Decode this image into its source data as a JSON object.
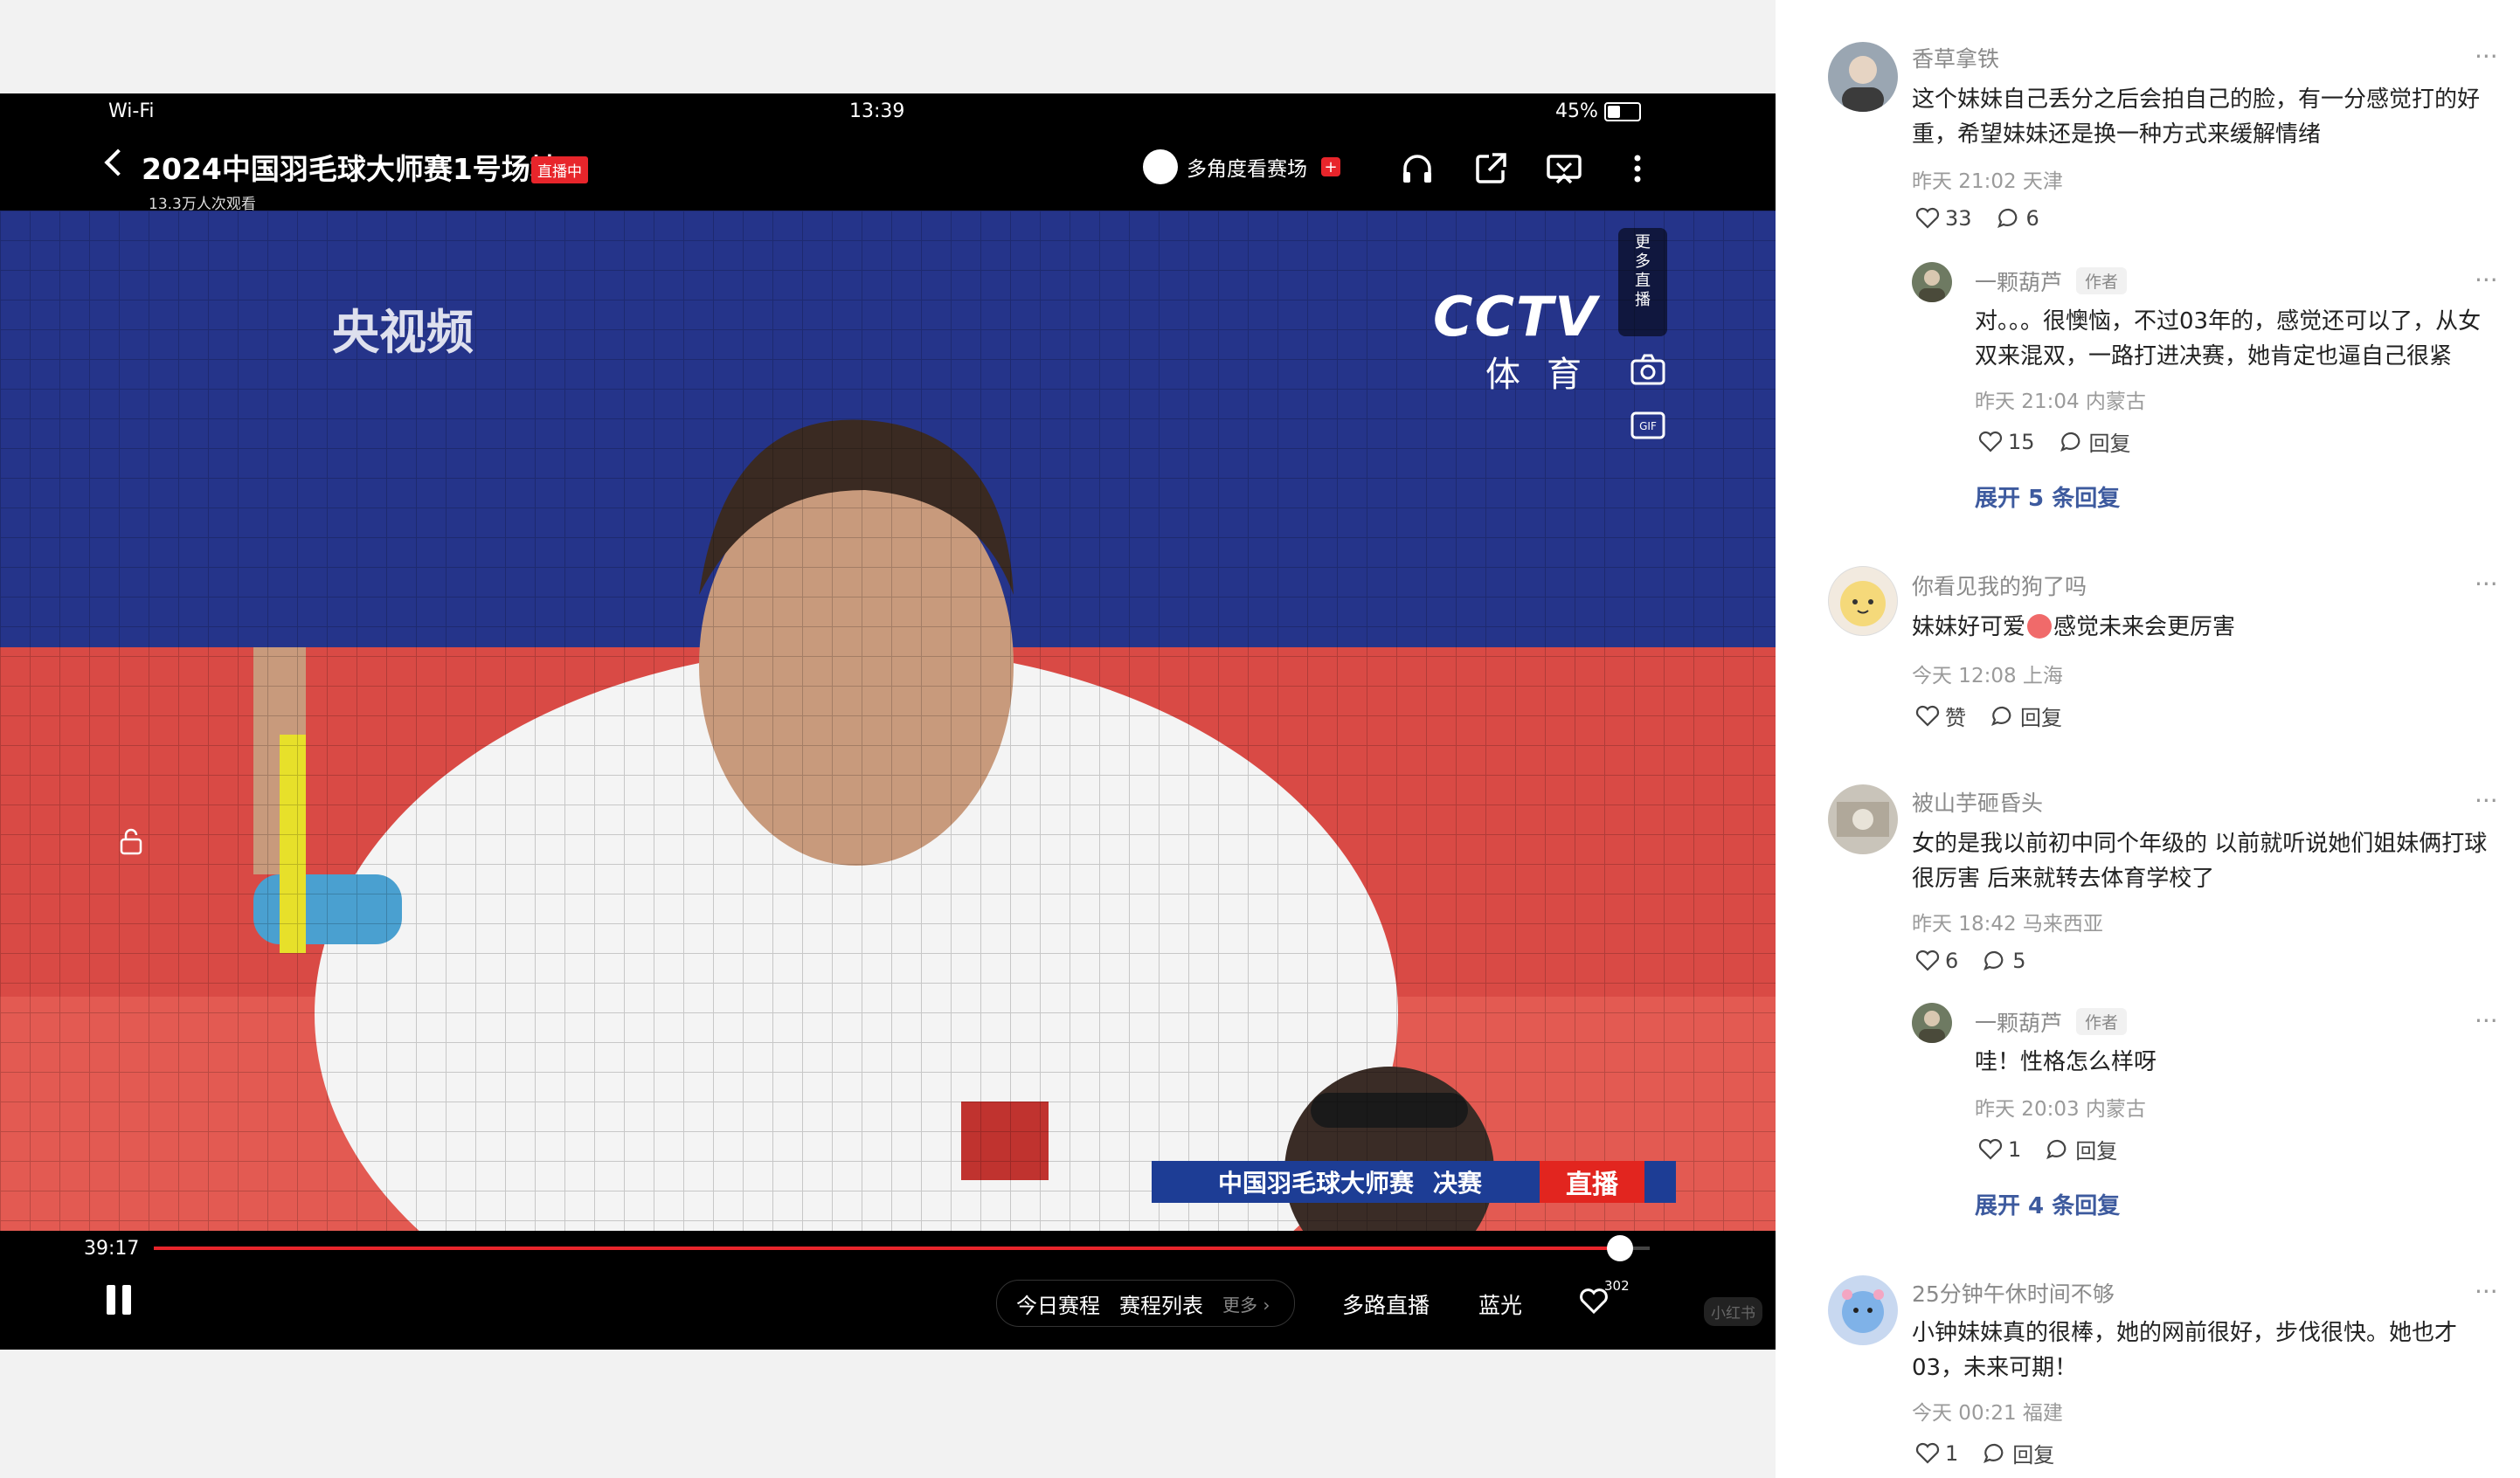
{
  "status_bar": {
    "wifi": "Wi-Fi",
    "time": "13:39",
    "battery": "45%"
  },
  "player": {
    "title": "2024中国羽毛球大师赛1号场地",
    "live_badge": "直播中",
    "viewers": "13.3万人次观看",
    "multi_angle_label": "多角度看赛场",
    "more_live": [
      "更",
      "多",
      "直",
      "播"
    ],
    "watermark_left": "央视频",
    "watermark_cctv": "CCTV",
    "watermark_sport": "体育",
    "ticker_event": "中国羽毛球大师赛",
    "ticker_round": "决赛",
    "ticker_live": "直播",
    "time_elapsed": "39:17",
    "progress_fraction": 0.98,
    "today_schedule": "今日赛程",
    "schedule_list": "赛程列表",
    "more": "更多",
    "multi_live": "多路直播",
    "quality": "蓝光",
    "like_count": "302",
    "corner_mark": "小红书"
  },
  "comments": [
    {
      "name": "香草拿铁",
      "text": "这个妹妹自己丢分之后会拍自己的脸，有一分感觉打的好重，希望妹妹还是换一种方式来缓解情绪",
      "meta": "昨天 21:02 天津",
      "likes": "33",
      "replies": "6",
      "more": "···"
    },
    {
      "name": "一颗葫芦",
      "author": "作者",
      "text": "对。。。很懊恼，不过03年的，感觉还可以了，从女双来混双，一路打进决赛，她肯定也逼自己很紧",
      "meta": "昨天 21:04 内蒙古",
      "likes": "15",
      "replies": "回复",
      "more": "···",
      "expand": "展开 5 条回复"
    },
    {
      "name": "你看见我的狗了吗",
      "text_before": "妹妹好可爱",
      "text_after": "感觉未来会更厉害",
      "meta": "今天 12:08 上海",
      "likes": "赞",
      "replies": "回复",
      "more": "···"
    },
    {
      "name": "被山芋砸昏头",
      "text": "女的是我以前初中同个年级的 以前就听说她们姐妹俩打球很厉害 后来就转去体育学校了",
      "meta": "昨天 18:42 马来西亚",
      "likes": "6",
      "replies": "5",
      "more": "···"
    },
    {
      "name": "一颗葫芦",
      "author": "作者",
      "text": "哇！性格怎么样呀",
      "meta": "昨天 20:03 内蒙古",
      "likes": "1",
      "replies": "回复",
      "more": "···",
      "expand": "展开 4 条回复"
    },
    {
      "name": "25分钟午休时间不够",
      "text": "小钟妹妹真的很棒，她的网前很好，步伐很快。她也才03，未来可期！",
      "meta": "今天 00:21 福建",
      "likes": "1",
      "replies": "回复",
      "more": "···"
    }
  ]
}
